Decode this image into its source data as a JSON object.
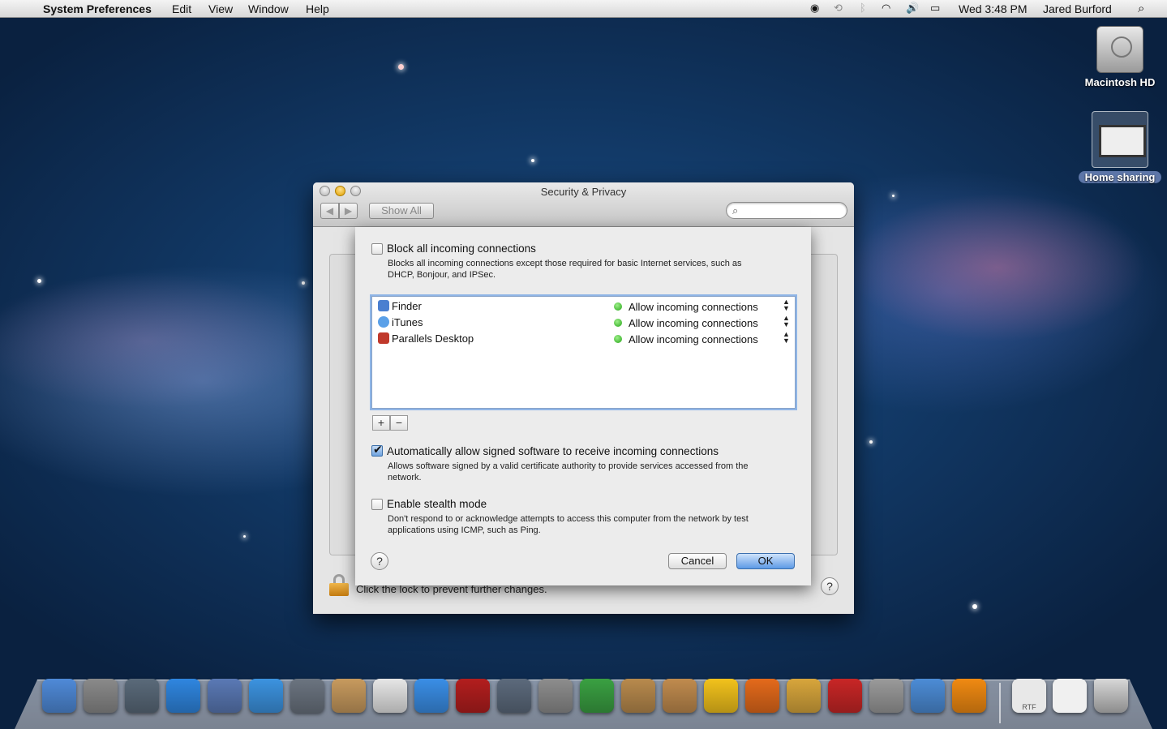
{
  "menubar": {
    "app_name": "System Preferences",
    "menus": [
      "Edit",
      "View",
      "Window",
      "Help"
    ],
    "clock": "Wed 3:48 PM",
    "user": "Jared Burford"
  },
  "desktop": {
    "icons": [
      {
        "label": "Macintosh HD",
        "icon": "hard-drive-icon"
      },
      {
        "label": "Home sharing",
        "icon": "screen-sharing-icon"
      }
    ]
  },
  "window": {
    "title": "Security & Privacy",
    "show_all": "Show All",
    "lock_text": "Click the lock to prevent further changes."
  },
  "sheet": {
    "block_all": {
      "title": "Block all incoming connections",
      "desc": "Blocks all incoming connections except those required for basic Internet services, such as DHCP, Bonjour, and IPSec.",
      "checked": false
    },
    "apps": [
      {
        "name": "Finder",
        "status": "Allow incoming connections",
        "color": "#4a7fd0"
      },
      {
        "name": "iTunes",
        "status": "Allow incoming connections",
        "color": "#5aa0e8"
      },
      {
        "name": "Parallels Desktop",
        "status": "Allow incoming connections",
        "color": "#c0392b"
      }
    ],
    "add_label": "+",
    "remove_label": "−",
    "auto_signed": {
      "title": "Automatically allow signed software to receive incoming connections",
      "desc": "Allows software signed by a valid certificate authority to provide services accessed from the network.",
      "checked": true
    },
    "stealth": {
      "title": "Enable stealth mode",
      "desc": "Don't respond to or acknowledge attempts to access this computer from the network by test applications using ICMP, such as Ping.",
      "checked": false
    },
    "help_label": "?",
    "cancel_label": "Cancel",
    "ok_label": "OK"
  },
  "dock": {
    "icons": [
      {
        "name": "finder-icon",
        "color": "#4f8ad8"
      },
      {
        "name": "launchpad-icon",
        "color": "#8a8a8a"
      },
      {
        "name": "mission-control-icon",
        "color": "#5a6a7a"
      },
      {
        "name": "app-store-icon",
        "color": "#2f86e0"
      },
      {
        "name": "mail-stamp-icon",
        "color": "#5a79b5"
      },
      {
        "name": "safari-icon",
        "color": "#3c93e0"
      },
      {
        "name": "facetime-icon",
        "color": "#6b7480"
      },
      {
        "name": "address-book-icon",
        "color": "#c79a5e"
      },
      {
        "name": "ical-icon",
        "color": "#e6e6e6"
      },
      {
        "name": "itunes-icon",
        "color": "#3a8ee6"
      },
      {
        "name": "photo-booth-icon",
        "color": "#b31e1e"
      },
      {
        "name": "iphoto-icon",
        "color": "#5c6a7c"
      },
      {
        "name": "system-preferences-icon",
        "color": "#8d8d8d"
      },
      {
        "name": "adium-icon",
        "color": "#3aa042"
      },
      {
        "name": "archive-utility-icon",
        "color": "#b88a4d"
      },
      {
        "name": "compress-icon",
        "color": "#c08b4e"
      },
      {
        "name": "cyberduck-icon",
        "color": "#f2c21c"
      },
      {
        "name": "firefox-icon",
        "color": "#e46a1b"
      },
      {
        "name": "cocktail-icon",
        "color": "#d8a63c"
      },
      {
        "name": "parallels-icon",
        "color": "#c82626"
      },
      {
        "name": "utility-icon",
        "color": "#9a9a9a"
      },
      {
        "name": "transmit-icon",
        "color": "#4c8cd6"
      },
      {
        "name": "vlc-icon",
        "color": "#f08a12"
      }
    ],
    "stacks": [
      {
        "name": "rtf-document-icon",
        "label": "RTF"
      },
      {
        "name": "document-icon",
        "label": ""
      },
      {
        "name": "trash-icon",
        "label": ""
      }
    ]
  }
}
